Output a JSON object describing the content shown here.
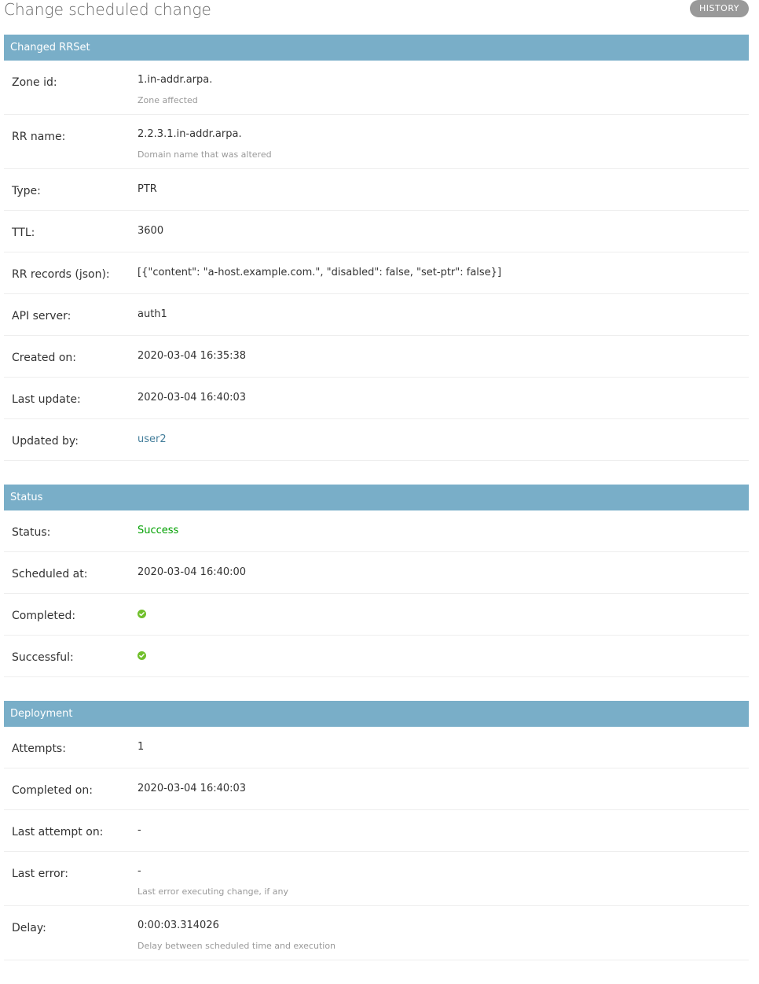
{
  "page": {
    "title": "Change scheduled change",
    "history_label": "HISTORY"
  },
  "sections": {
    "changed_rrset": {
      "title": "Changed RRSet",
      "zone_id": {
        "label": "Zone id:",
        "value": "1.in-addr.arpa.",
        "help": "Zone affected"
      },
      "rr_name": {
        "label": "RR name:",
        "value": "2.2.3.1.in-addr.arpa.",
        "help": "Domain name that was altered"
      },
      "type": {
        "label": "Type:",
        "value": "PTR"
      },
      "ttl": {
        "label": "TTL:",
        "value": "3600"
      },
      "rr_records": {
        "label": "RR records (json):",
        "value": "[{\"content\": \"a-host.example.com.\", \"disabled\": false, \"set-ptr\": false}]"
      },
      "api_server": {
        "label": "API server:",
        "value": "auth1"
      },
      "created_on": {
        "label": "Created on:",
        "value": "2020-03-04 16:35:38"
      },
      "last_update": {
        "label": "Last update:",
        "value": "2020-03-04 16:40:03"
      },
      "updated_by": {
        "label": "Updated by:",
        "value": "user2"
      }
    },
    "status": {
      "title": "Status",
      "status": {
        "label": "Status:",
        "value": "Success",
        "color": "#00a000"
      },
      "scheduled_at": {
        "label": "Scheduled at:",
        "value": "2020-03-04 16:40:00"
      },
      "completed": {
        "label": "Completed:",
        "icon": "check-circle-icon",
        "state": true
      },
      "successful": {
        "label": "Successful:",
        "icon": "check-circle-icon",
        "state": true
      }
    },
    "deployment": {
      "title": "Deployment",
      "attempts": {
        "label": "Attempts:",
        "value": "1"
      },
      "completed_on": {
        "label": "Completed on:",
        "value": "2020-03-04 16:40:03"
      },
      "last_attempt_on": {
        "label": "Last attempt on:",
        "value": "-"
      },
      "last_error": {
        "label": "Last error:",
        "value": "-",
        "help": "Last error executing change, if any"
      },
      "delay": {
        "label": "Delay:",
        "value": "0:00:03.314026",
        "help": "Delay between scheduled time and execution"
      }
    }
  },
  "colors": {
    "section_header_bg": "#79aec8",
    "link": "#447e9b",
    "success": "#00a000",
    "check_icon": "#70bf2b",
    "history_button_bg": "#999999"
  }
}
